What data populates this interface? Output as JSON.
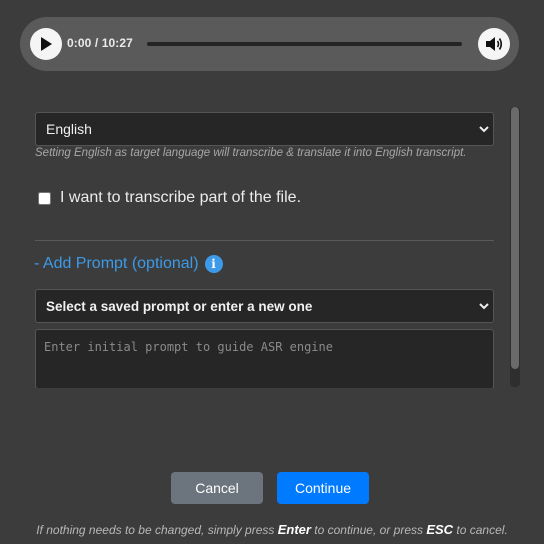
{
  "player": {
    "time": "0:00 / 10:27",
    "play_icon": "play-icon",
    "volume_icon": "volume-icon"
  },
  "language": {
    "selected": "English",
    "hint": "Setting English as target language will transcribe & translate it into English transcript."
  },
  "partial": {
    "label": "I want to transcribe part of the file.",
    "checked": false
  },
  "prompt": {
    "toggle_label": "- Add Prompt (optional)",
    "select_value": "Select a saved prompt or enter a new one",
    "textarea_placeholder": "Enter initial prompt to guide ASR engine"
  },
  "buttons": {
    "cancel": "Cancel",
    "continue": "Continue"
  },
  "footer": {
    "part1": "If nothing needs to be changed, simply press ",
    "key_enter": "Enter",
    "part2": " to continue, or press ",
    "key_esc": "ESC",
    "part3": " to cancel."
  },
  "colors": {
    "accent": "#007bff",
    "link": "#3d9ae8",
    "secondary": "#6c757d"
  }
}
